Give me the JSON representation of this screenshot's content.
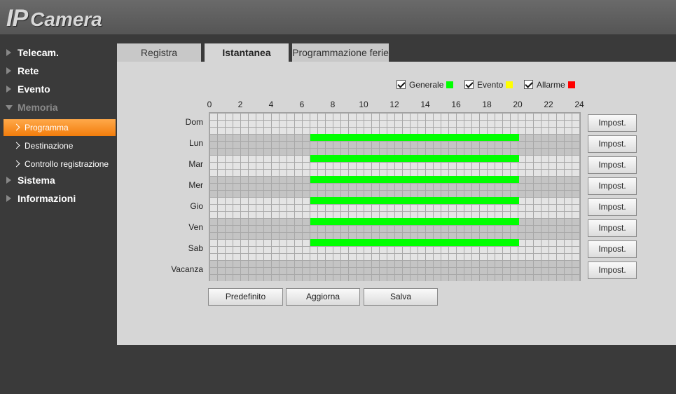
{
  "app": {
    "logo_ip": "IP",
    "logo_camera": "Camera"
  },
  "sidebar": {
    "items": [
      {
        "label": "Telecam.",
        "expanded": false
      },
      {
        "label": "Rete",
        "expanded": false
      },
      {
        "label": "Evento",
        "expanded": false
      },
      {
        "label": "Memoria",
        "expanded": true
      },
      {
        "label": "Programma",
        "sub": true,
        "active": true
      },
      {
        "label": "Destinazione",
        "sub": true
      },
      {
        "label": "Controllo registrazione",
        "sub": true
      },
      {
        "label": "Sistema",
        "expanded": false
      },
      {
        "label": "Informazioni",
        "expanded": false
      }
    ]
  },
  "tabs": [
    {
      "label": "Registra",
      "active": false
    },
    {
      "label": "Istantanea",
      "active": true
    },
    {
      "label": "Programmazione ferie",
      "active": false
    }
  ],
  "legend": [
    {
      "label": "Generale",
      "checked": true,
      "color": "#00ff00"
    },
    {
      "label": "Evento",
      "checked": true,
      "color": "#ffff00"
    },
    {
      "label": "Allarme",
      "checked": true,
      "color": "#ff0000"
    }
  ],
  "hours": [
    "0",
    "2",
    "4",
    "6",
    "8",
    "10",
    "12",
    "14",
    "16",
    "18",
    "20",
    "22",
    "24"
  ],
  "days": [
    {
      "label": "Dom",
      "segments": []
    },
    {
      "label": "Lun",
      "segments": [
        {
          "start": 6,
          "end": 20,
          "type": "Generale"
        }
      ]
    },
    {
      "label": "Mar",
      "segments": [
        {
          "start": 6,
          "end": 20,
          "type": "Generale"
        }
      ]
    },
    {
      "label": "Mer",
      "segments": [
        {
          "start": 6,
          "end": 20,
          "type": "Generale"
        }
      ]
    },
    {
      "label": "Gio",
      "segments": [
        {
          "start": 6,
          "end": 20,
          "type": "Generale"
        }
      ]
    },
    {
      "label": "Ven",
      "segments": [
        {
          "start": 6,
          "end": 20,
          "type": "Generale"
        }
      ]
    },
    {
      "label": "Sab",
      "segments": [
        {
          "start": 6,
          "end": 20,
          "type": "Generale"
        }
      ]
    },
    {
      "label": "Vacanza",
      "segments": []
    }
  ],
  "set_button_label": "Impost.",
  "buttons": {
    "default": "Predefinito",
    "refresh": "Aggiorna",
    "save": "Salva"
  }
}
